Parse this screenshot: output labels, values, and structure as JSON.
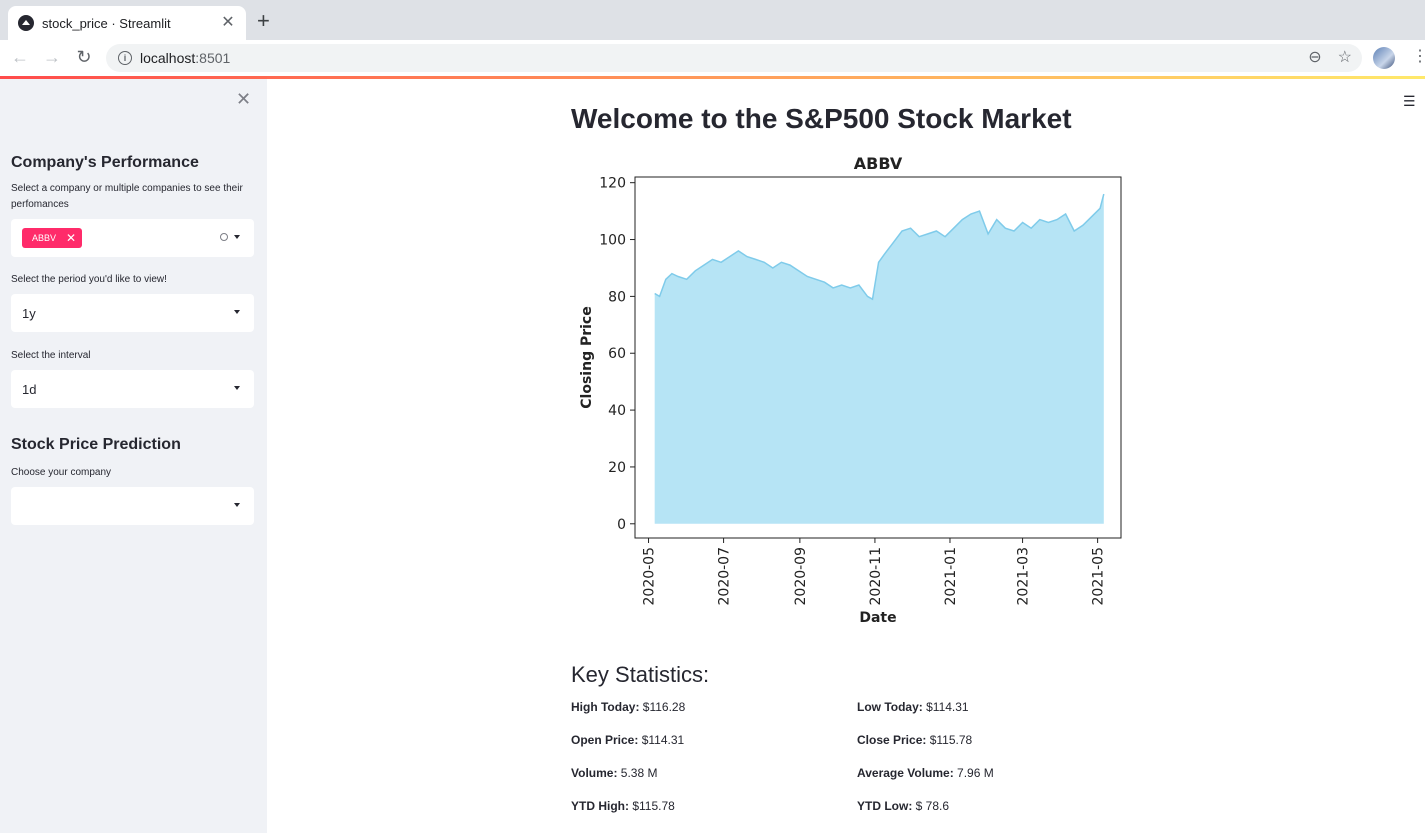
{
  "browser": {
    "tab_title": "stock_price · Streamlit",
    "url_host": "localhost",
    "url_port": ":8501"
  },
  "sidebar": {
    "section1_title": "Company's Performance",
    "company_label": "Select a company or multiple companies to see their perfomances",
    "selected_company": "ABBV",
    "period_label": "Select the period you'd like to view!",
    "period_value": "1y",
    "interval_label": "Select the interval",
    "interval_value": "1d",
    "section2_title": "Stock Price Prediction",
    "predict_label": "Choose your company",
    "predict_value": ""
  },
  "main": {
    "title": "Welcome to the S&P500 Stock Market",
    "stats_title": "Key Statistics:",
    "stats": [
      {
        "label": "High Today:",
        "value": " $116.28"
      },
      {
        "label": "Low Today:",
        "value": " $114.31"
      },
      {
        "label": "Open Price:",
        "value": " $114.31"
      },
      {
        "label": "Close Price:",
        "value": " $115.78"
      },
      {
        "label": "Volume:",
        "value": " 5.38 M"
      },
      {
        "label": "Average Volume:",
        "value": " 7.96 M"
      },
      {
        "label": "YTD High:",
        "value": " $115.78"
      },
      {
        "label": "YTD Low:",
        "value": " $ 78.6"
      }
    ]
  },
  "colors": {
    "accent": "#ff2b6a",
    "area_fill": "#b6e4f5",
    "area_line": "#7fcbea"
  },
  "chart_data": {
    "type": "area",
    "title": "ABBV",
    "xlabel": "Date",
    "ylabel": "Closing Price",
    "ylim": [
      -5,
      122
    ],
    "yticks": [
      0,
      20,
      40,
      60,
      80,
      100,
      120
    ],
    "xticks": [
      "2020-05",
      "2020-07",
      "2020-09",
      "2020-11",
      "2021-01",
      "2021-03",
      "2021-05"
    ],
    "grid": false,
    "series": [
      {
        "x": [
          "2020-05-06",
          "2020-05-10",
          "2020-05-15",
          "2020-05-20",
          "2020-05-25",
          "2020-06-01",
          "2020-06-08",
          "2020-06-15",
          "2020-06-22",
          "2020-06-29",
          "2020-07-06",
          "2020-07-13",
          "2020-07-20",
          "2020-07-27",
          "2020-08-03",
          "2020-08-10",
          "2020-08-17",
          "2020-08-24",
          "2020-08-31",
          "2020-09-07",
          "2020-09-14",
          "2020-09-21",
          "2020-09-28",
          "2020-10-05",
          "2020-10-12",
          "2020-10-19",
          "2020-10-26",
          "2020-10-30",
          "2020-11-04",
          "2020-11-09",
          "2020-11-16",
          "2020-11-23",
          "2020-11-30",
          "2020-12-07",
          "2020-12-14",
          "2020-12-21",
          "2020-12-28",
          "2021-01-04",
          "2021-01-11",
          "2021-01-18",
          "2021-01-25",
          "2021-02-01",
          "2021-02-08",
          "2021-02-15",
          "2021-02-22",
          "2021-03-01",
          "2021-03-08",
          "2021-03-15",
          "2021-03-22",
          "2021-03-29",
          "2021-04-05",
          "2021-04-12",
          "2021-04-19",
          "2021-04-26",
          "2021-05-03",
          "2021-05-06"
        ],
        "y": [
          81,
          80,
          86,
          88,
          87,
          86,
          89,
          91,
          93,
          92,
          94,
          96,
          94,
          93,
          92,
          90,
          92,
          91,
          89,
          87,
          86,
          85,
          83,
          84,
          83,
          84,
          80,
          79,
          92,
          95,
          99,
          103,
          104,
          101,
          102,
          103,
          101,
          104,
          107,
          109,
          110,
          102,
          107,
          104,
          103,
          106,
          104,
          107,
          106,
          107,
          109,
          103,
          105,
          108,
          111,
          116
        ]
      }
    ]
  }
}
